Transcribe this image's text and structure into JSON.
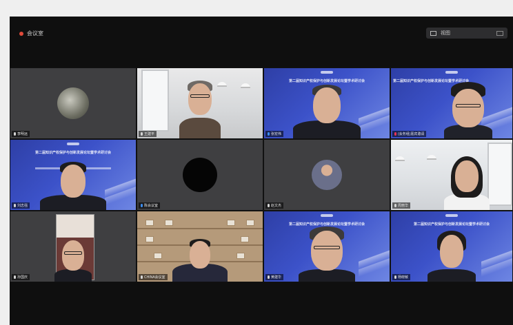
{
  "app": {
    "title": "会议室"
  },
  "toolbar": {
    "view_label": "视图"
  },
  "participants": [
    {
      "name": "李明远"
    },
    {
      "name": "王建平"
    },
    {
      "name": "张宏伟"
    },
    {
      "name": "(会务组)嘉宾邀请"
    },
    {
      "name": "刘志强"
    },
    {
      "name": "陈会议室"
    },
    {
      "name": "赵文杰"
    },
    {
      "name": "周丽华"
    },
    {
      "name": "孙国庆"
    },
    {
      "name": "CHINA会议室"
    },
    {
      "name": "黄建华"
    },
    {
      "name": "杨晓敏"
    }
  ],
  "conference_slide": {
    "title": "第二届知识产权保护与创新发展论坛暨学术研讨会"
  }
}
